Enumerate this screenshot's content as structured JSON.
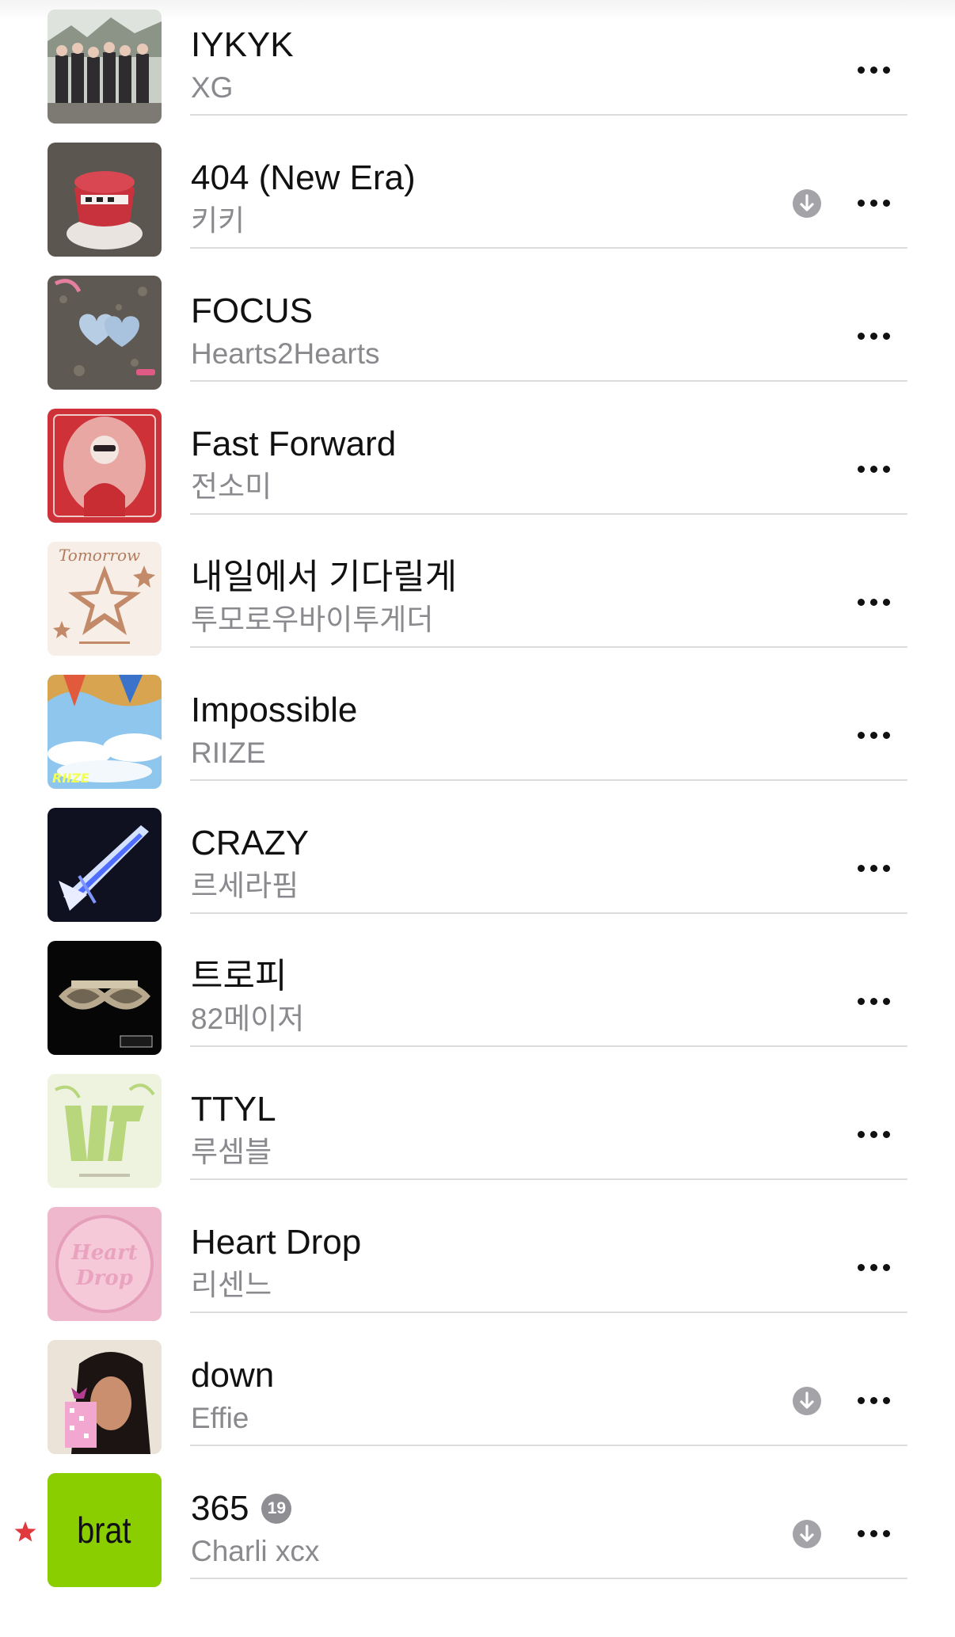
{
  "tracks": [
    {
      "title": "IYKYK",
      "artist": "XG",
      "downloadable": false,
      "explicit": false,
      "favorite": false,
      "art": "art-xg"
    },
    {
      "title": "404 (New Era)",
      "artist": "키키",
      "downloadable": true,
      "explicit": false,
      "favorite": false,
      "art": "art-kiki"
    },
    {
      "title": "FOCUS",
      "artist": "Hearts2Hearts",
      "downloadable": false,
      "explicit": false,
      "favorite": false,
      "art": "art-h2h"
    },
    {
      "title": "Fast Forward",
      "artist": "전소미",
      "downloadable": false,
      "explicit": false,
      "favorite": false,
      "art": "art-somi"
    },
    {
      "title": "내일에서 기다릴게",
      "artist": "투모로우바이투게더",
      "downloadable": false,
      "explicit": false,
      "favorite": false,
      "art": "art-txt",
      "art_text": "Tomorrow"
    },
    {
      "title": "Impossible",
      "artist": "RIIZE",
      "downloadable": false,
      "explicit": false,
      "favorite": false,
      "art": "art-riize",
      "art_text": "RIIZE"
    },
    {
      "title": "CRAZY",
      "artist": "르세라핌",
      "downloadable": false,
      "explicit": false,
      "favorite": false,
      "art": "art-lsf"
    },
    {
      "title": "트로피",
      "artist": "82메이저",
      "downloadable": false,
      "explicit": false,
      "favorite": false,
      "art": "art-82"
    },
    {
      "title": "TTYL",
      "artist": "루셈블",
      "downloadable": false,
      "explicit": false,
      "favorite": false,
      "art": "art-loossemble"
    },
    {
      "title": "Heart Drop",
      "artist": "리센느",
      "downloadable": false,
      "explicit": false,
      "favorite": false,
      "art": "art-rescene",
      "art_text": "Heart Drop"
    },
    {
      "title": "down",
      "artist": "Effie",
      "downloadable": true,
      "explicit": false,
      "favorite": false,
      "art": "art-effie"
    },
    {
      "title": "365",
      "artist": "Charli xcx",
      "downloadable": true,
      "explicit": true,
      "explicit_label": "19",
      "favorite": true,
      "art": "art-brat",
      "art_text": "brat"
    }
  ],
  "icons": {
    "download": "arrow-down-circle-icon",
    "more": "ellipsis-icon",
    "favorite": "star-icon",
    "explicit": "age-rating-badge"
  },
  "colors": {
    "accent": "#e03a3e",
    "secondary_text": "#8a8a8e",
    "brat_green": "#8ace00"
  }
}
